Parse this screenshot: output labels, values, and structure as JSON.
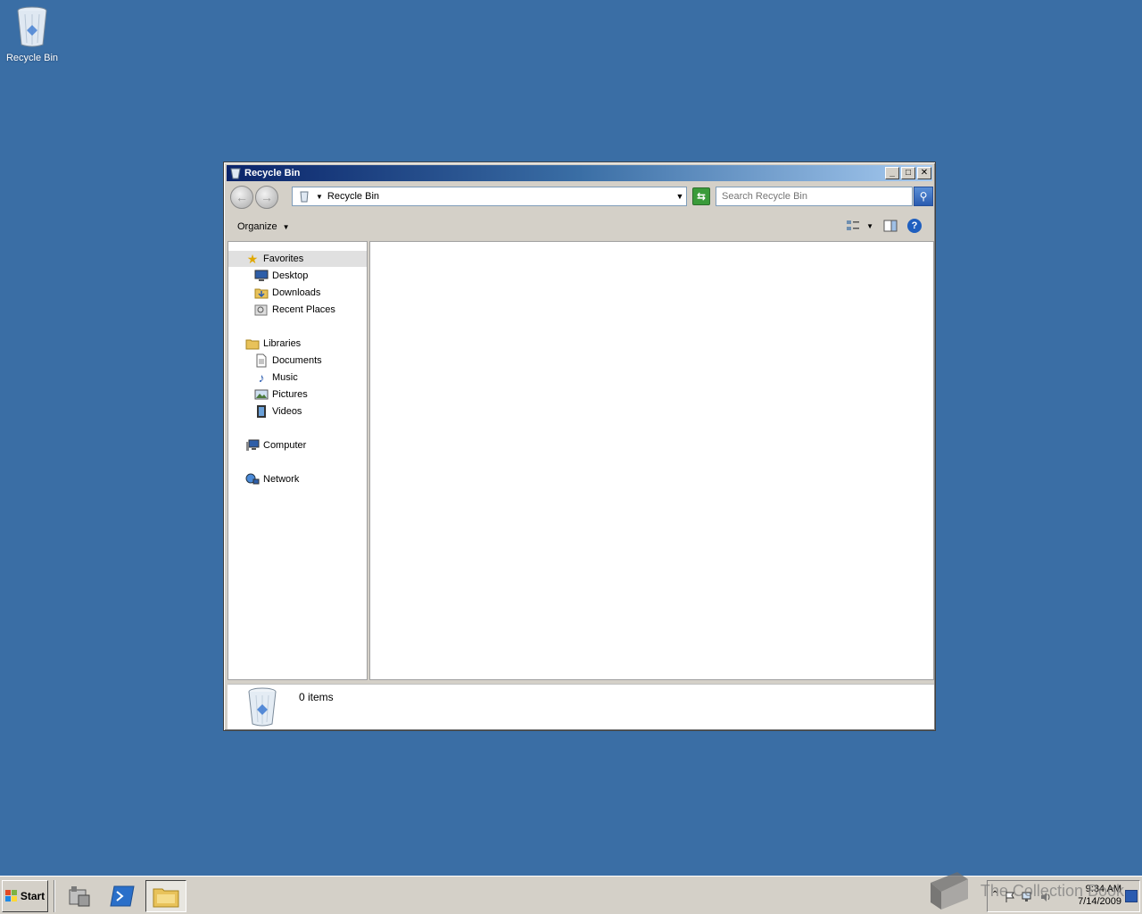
{
  "desktop": {
    "icons": [
      {
        "label": "Recycle Bin",
        "icon": "recycle-bin-icon"
      }
    ],
    "background_color": "#3a6ea5"
  },
  "window": {
    "title": "Recycle Bin",
    "controls": {
      "minimize": "minimize-icon",
      "maximize": "maximize-icon",
      "close": "close-icon"
    },
    "address": {
      "crumb": "Recycle Bin"
    },
    "search": {
      "placeholder": "Search Recycle Bin"
    },
    "commandbar": {
      "organize_label": "Organize"
    },
    "navpane": {
      "favorites": {
        "label": "Favorites",
        "items": [
          "Desktop",
          "Downloads",
          "Recent Places"
        ]
      },
      "libraries": {
        "label": "Libraries",
        "items": [
          "Documents",
          "Music",
          "Pictures",
          "Videos"
        ]
      },
      "computer": "Computer",
      "network": "Network"
    },
    "details": {
      "item_count": "0 items"
    }
  },
  "taskbar": {
    "start_label": "Start",
    "clock": {
      "time": "9:34 AM",
      "date": "7/14/2009"
    }
  },
  "watermark": {
    "text": "The Collection Book"
  }
}
